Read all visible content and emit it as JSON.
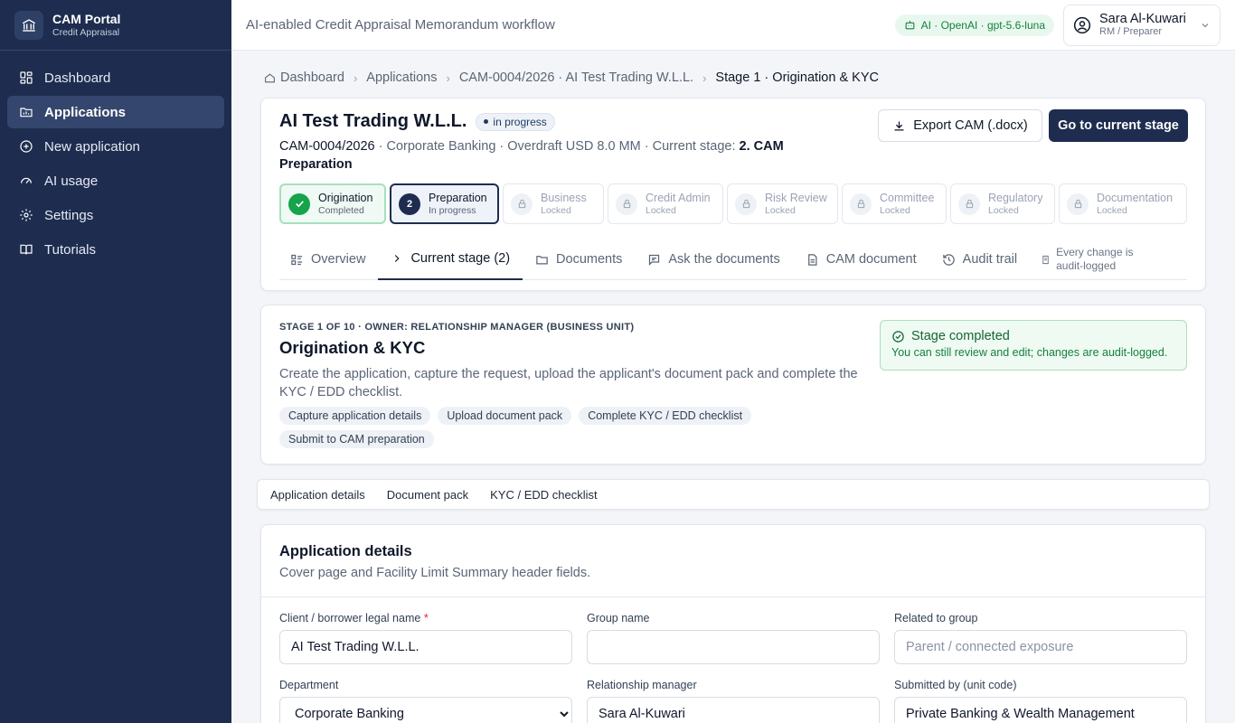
{
  "brand": {
    "title": "CAM Portal",
    "subtitle": "Credit Appraisal"
  },
  "sidebar": {
    "items": [
      {
        "label": "Dashboard",
        "icon": "dashboard-icon"
      },
      {
        "label": "Applications",
        "icon": "applications-icon",
        "active": true
      },
      {
        "label": "New application",
        "icon": "plus-circle-icon"
      },
      {
        "label": "AI usage",
        "icon": "gauge-icon"
      },
      {
        "label": "Settings",
        "icon": "gear-icon"
      },
      {
        "label": "Tutorials",
        "icon": "book-icon"
      }
    ]
  },
  "topbar": {
    "title": "AI-enabled Credit Appraisal Memorandum workflow",
    "ai_label": "AI · OpenAI · gpt-5.6-luna",
    "user_name": "Sara Al-Kuwari",
    "user_role": "RM / Preparer"
  },
  "breadcrumb": [
    "Dashboard",
    "Applications",
    "CAM-0004/2026 · AI Test Trading W.L.L.",
    "Stage 1 · Origination & KYC"
  ],
  "header": {
    "title": "AI Test Trading W.L.L.",
    "status": "in progress",
    "ref": "CAM-0004/2026",
    "meta": " · Corporate Banking · Overdraft USD 8.0 MM · Current stage: ",
    "current_stage": "2. CAM Preparation",
    "export_label": "Export CAM (.docx)",
    "goto_label": "Go to current stage"
  },
  "stages": [
    {
      "name": "Origination",
      "status": "Completed",
      "state": "done",
      "width": 118
    },
    {
      "name": "Preparation",
      "status": "In progress",
      "state": "cur",
      "width": 121,
      "num": "2"
    },
    {
      "name": "Business",
      "status": "Locked",
      "state": "lock",
      "width": 112
    },
    {
      "name": "Credit Admin",
      "status": "Locked",
      "state": "lock",
      "width": 128
    },
    {
      "name": "Risk Review",
      "status": "Locked",
      "state": "lock",
      "width": 123
    },
    {
      "name": "Committee",
      "status": "Locked",
      "state": "lock",
      "width": 116
    },
    {
      "name": "Regulatory",
      "status": "Locked",
      "state": "lock",
      "width": 116
    },
    {
      "name": "Documentation",
      "status": "Locked",
      "state": "lock",
      "width": 142
    }
  ],
  "tabs": [
    {
      "label": "Overview",
      "icon": "overview-icon"
    },
    {
      "label": "Current stage (2)",
      "icon": "chevron-right-icon",
      "active": true
    },
    {
      "label": "Documents",
      "icon": "folder-icon"
    },
    {
      "label": "Ask the documents",
      "icon": "chat-icon"
    },
    {
      "label": "CAM document",
      "icon": "document-icon"
    },
    {
      "label": "Audit trail",
      "icon": "history-icon"
    }
  ],
  "audit_note": "Every change is audit-logged",
  "stage_card": {
    "eyebrow": "STAGE 1 OF 10 · OWNER: RELATIONSHIP MANAGER (BUSINESS UNIT)",
    "title": "Origination & KYC",
    "description": "Create the application, capture the request, upload the applicant's document pack and complete the KYC / EDD checklist.",
    "chips": [
      "Capture application details",
      "Upload document pack",
      "Complete KYC / EDD checklist",
      "Submit to CAM preparation"
    ],
    "done_title": "Stage completed",
    "done_sub": "You can still review and edit; changes are audit-logged."
  },
  "subtabs": [
    "Application details",
    "Document pack",
    "KYC / EDD checklist"
  ],
  "form": {
    "title": "Application details",
    "subtitle": "Cover page and Facility Limit Summary header fields.",
    "client_label": "Client / borrower legal name",
    "client_value": "AI Test Trading W.L.L.",
    "group_label": "Group name",
    "group_value": "",
    "related_label": "Related to group",
    "related_placeholder": "Parent / connected exposure",
    "department_label": "Department",
    "department_value": "Corporate Banking",
    "rm_label": "Relationship manager",
    "rm_value": "Sara Al-Kuwari",
    "submitted_label": "Submitted by (unit code)",
    "submitted_value": "Private Banking & Wealth Management"
  }
}
